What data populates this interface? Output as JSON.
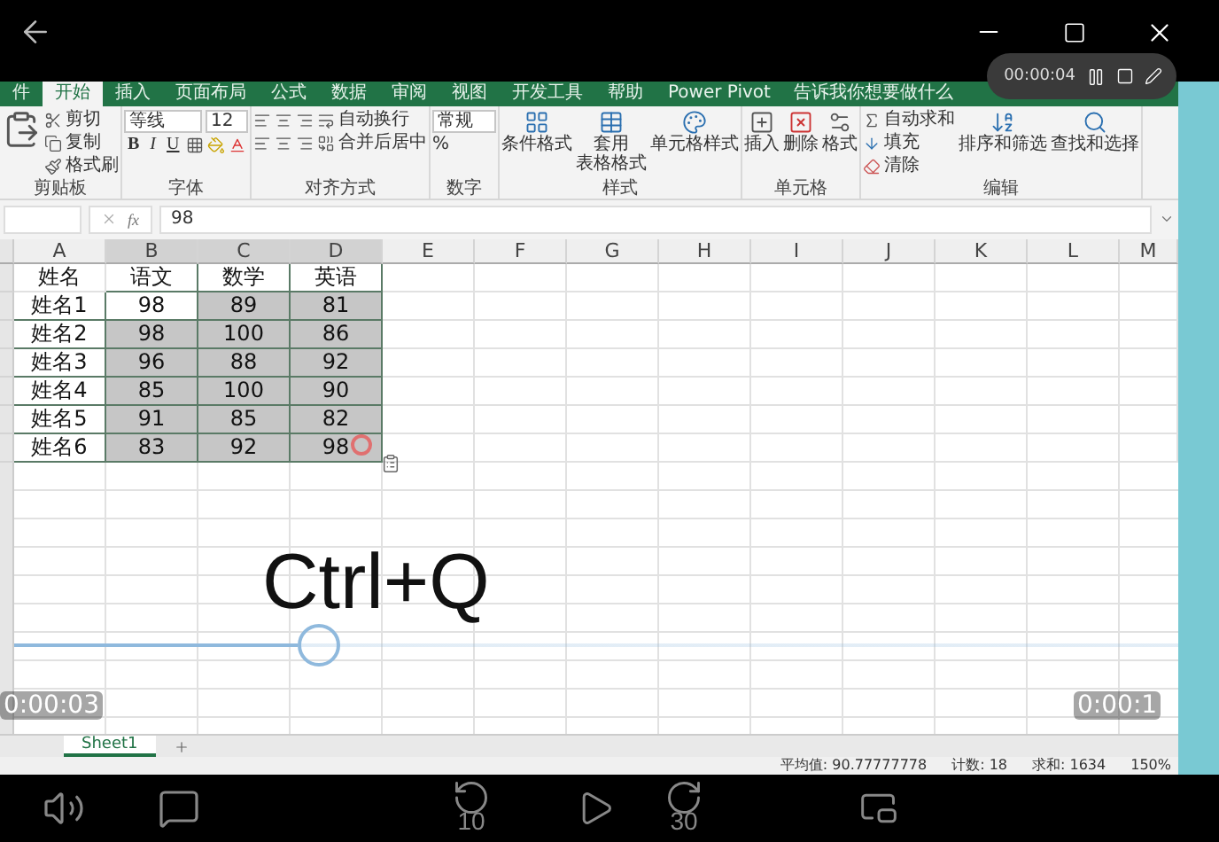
{
  "recorder": {
    "time": "00:00:04"
  },
  "excel": {
    "tabs": [
      {
        "label": "件",
        "selected": false
      },
      {
        "label": "开始",
        "selected": true
      },
      {
        "label": "插入",
        "selected": false
      },
      {
        "label": "页面布局",
        "selected": false
      },
      {
        "label": "公式",
        "selected": false
      },
      {
        "label": "数据",
        "selected": false
      },
      {
        "label": "审阅",
        "selected": false
      },
      {
        "label": "视图",
        "selected": false
      },
      {
        "label": "开发工具",
        "selected": false
      },
      {
        "label": "帮助",
        "selected": false
      },
      {
        "label": "Power Pivot",
        "selected": false
      }
    ],
    "tell_me": "告诉我你想要做什么",
    "ribbon": [
      {
        "kind": "clipboard",
        "label": "剪贴板",
        "items": [
          "剪切",
          "复制",
          "格式刷"
        ]
      },
      {
        "kind": "font",
        "label": "字体",
        "font": "等线",
        "size": "12",
        "marks": [
          "B",
          "I",
          "U"
        ]
      },
      {
        "kind": "alignment",
        "label": "对齐方式",
        "items": [
          "自动换行",
          "合并后居中"
        ]
      },
      {
        "kind": "number",
        "label": "数字",
        "format": "常规",
        "symbol": "%"
      },
      {
        "kind": "styles",
        "label": "样式",
        "items": [
          [
            "条件格式"
          ],
          [
            "套用",
            "表格格式"
          ],
          [
            "单元格样式"
          ]
        ]
      },
      {
        "kind": "cells",
        "label": "单元格",
        "items": [
          "插入",
          "删除",
          "格式"
        ]
      },
      {
        "kind": "editing",
        "label": "编辑",
        "items": [
          "自动求和",
          "填充",
          "清除"
        ],
        "large": [
          "排序和筛选",
          "查找和选择"
        ]
      }
    ],
    "formula": {
      "fx": "fx",
      "value": "98"
    },
    "columns": [
      "A",
      "B",
      "C",
      "D",
      "E",
      "F",
      "G",
      "H",
      "I",
      "J",
      "K",
      "L",
      "M"
    ],
    "rows": [
      [
        {
          "text": "姓名",
          "selected": false
        },
        {
          "text": "语文",
          "selected": false
        },
        {
          "text": "数学",
          "selected": false
        },
        {
          "text": "英语",
          "selected": false
        }
      ],
      [
        {
          "text": "姓名1",
          "selected": false
        },
        {
          "text": "98",
          "selected": false
        },
        {
          "text": "89",
          "selected": true
        },
        {
          "text": "81",
          "selected": true
        }
      ],
      [
        {
          "text": "姓名2",
          "selected": false
        },
        {
          "text": "98",
          "selected": true
        },
        {
          "text": "100",
          "selected": true
        },
        {
          "text": "86",
          "selected": true
        }
      ],
      [
        {
          "text": "姓名3",
          "selected": false
        },
        {
          "text": "96",
          "selected": true
        },
        {
          "text": "88",
          "selected": true
        },
        {
          "text": "92",
          "selected": true
        }
      ],
      [
        {
          "text": "姓名4",
          "selected": false
        },
        {
          "text": "85",
          "selected": true
        },
        {
          "text": "100",
          "selected": true
        },
        {
          "text": "90",
          "selected": true
        }
      ],
      [
        {
          "text": "姓名5",
          "selected": false
        },
        {
          "text": "91",
          "selected": true
        },
        {
          "text": "85",
          "selected": true
        },
        {
          "text": "82",
          "selected": true
        }
      ],
      [
        {
          "text": "姓名6",
          "selected": false
        },
        {
          "text": "83",
          "selected": true
        },
        {
          "text": "92",
          "selected": true
        },
        {
          "text": "98",
          "selected": true
        }
      ]
    ],
    "sheet_tabs": [
      {
        "label": "Sheet1",
        "selected": true
      }
    ],
    "status": [
      "平均值: 90.77777778",
      "计数: 18",
      "求和: 1634"
    ],
    "zoom": "150%"
  },
  "overlay_text": "Ctrl+Q",
  "player": {
    "elapsed": "0:00:03",
    "remaining": "0:00:1",
    "level": 0.24,
    "rewind": "10",
    "forward": "30"
  }
}
